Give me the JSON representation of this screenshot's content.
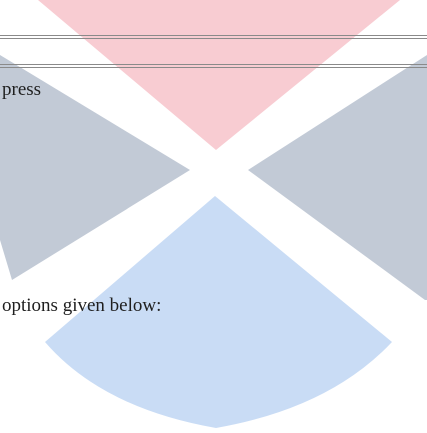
{
  "content": {
    "line_1": "press",
    "line_2": "options given below:"
  },
  "watermark": {
    "colors": {
      "top": "#f8ccd2",
      "sides": "#c2cad6",
      "bottom": "#c9dcf5"
    }
  }
}
